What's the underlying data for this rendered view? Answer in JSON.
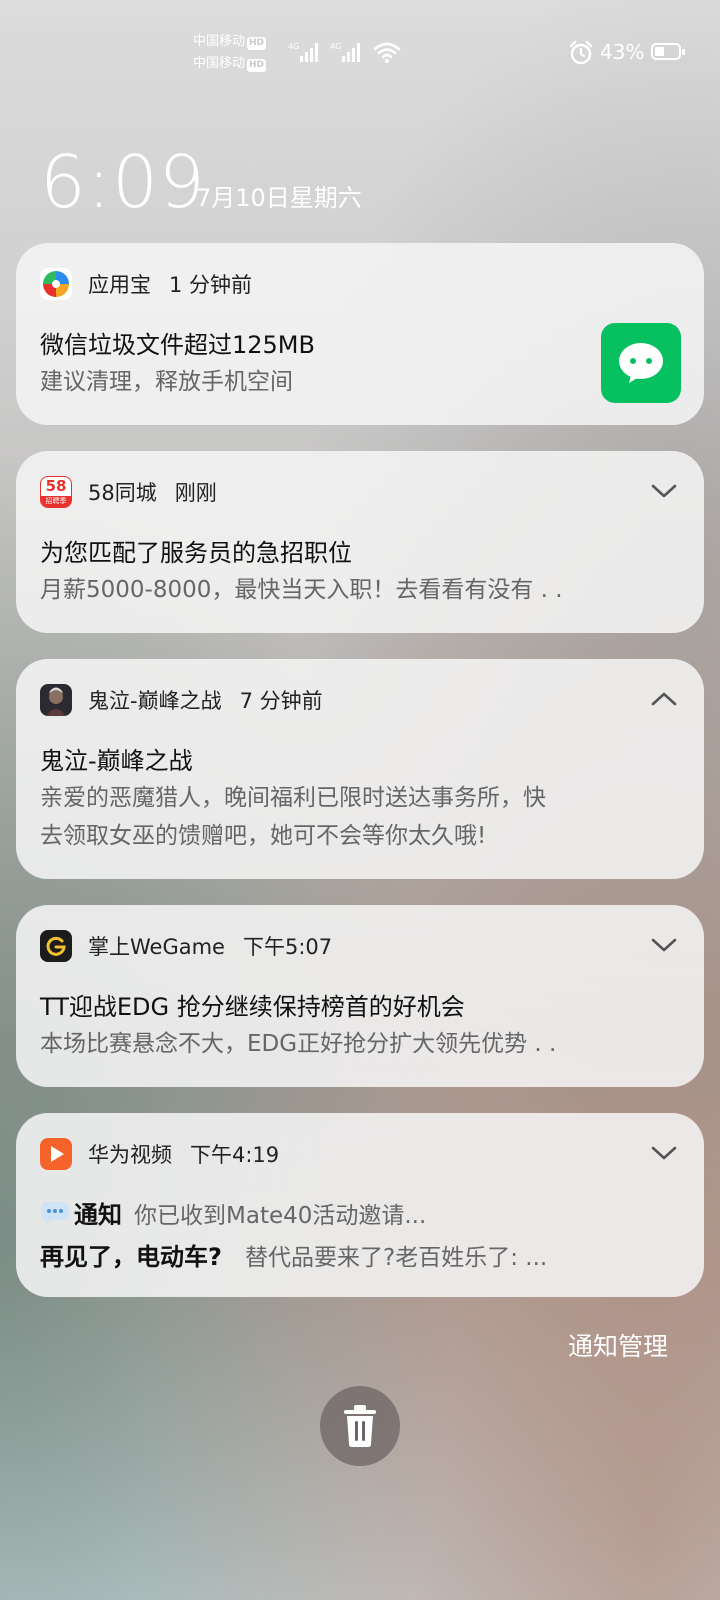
{
  "status_bar": {
    "carrier1": "中国移动",
    "carrier2": "中国移动",
    "hd_badge": "HD",
    "net1": "4G",
    "net2": "4G",
    "battery_percent": "43%",
    "battery_level": 0.43,
    "icons": [
      "signal-icon",
      "signal-icon",
      "wifi-icon",
      "alarm-icon",
      "battery-icon"
    ]
  },
  "lockscreen": {
    "time": "6:09",
    "date": "7月10日星期六"
  },
  "notifications": [
    {
      "app": "应用宝",
      "time": "1 分钟前",
      "title": "微信垃圾文件超过125MB",
      "body": "建议清理，释放手机空间",
      "thumbnail_icon": "wechat-icon"
    },
    {
      "app": "58同城",
      "time": "刚刚",
      "icon_text": "58",
      "icon_subtext": "招聘季",
      "title": "为您匹配了服务员的急招职位",
      "body": "月薪5000-8000，最快当天入职！去看看有没有 . ."
    },
    {
      "app": "鬼泣-巅峰之战",
      "time": "7 分钟前",
      "title": "鬼泣-巅峰之战",
      "body_line1": "亲爱的恶魔猎人，晚间福利已限时送达事务所，快",
      "body_line2": "去领取女巫的馈赠吧，她可不会等你太久哦!"
    },
    {
      "app": "掌上WeGame",
      "time": "下午5:07",
      "title": "TT迎战EDG 抢分继续保持榜首的好机会",
      "body": "本场比赛悬念不大，EDG正好抢分扩大领先优势 . ."
    },
    {
      "app": "华为视频",
      "time": "下午4:19",
      "line1_label": "通知",
      "line1_text": "你已收到Mate40活动邀请...",
      "line2_label": "再见了，电动车?",
      "line2_text": "替代品要来了?老百姓乐了: ..."
    }
  ],
  "footer": {
    "manage_label": "通知管理"
  },
  "colors": {
    "card_bg": "#f4f4f4",
    "wechat_green": "#07c160",
    "tencent_blue": "#2d8cf0",
    "58_red": "#e8302c",
    "huawei_video_orange": "#f5632a"
  }
}
